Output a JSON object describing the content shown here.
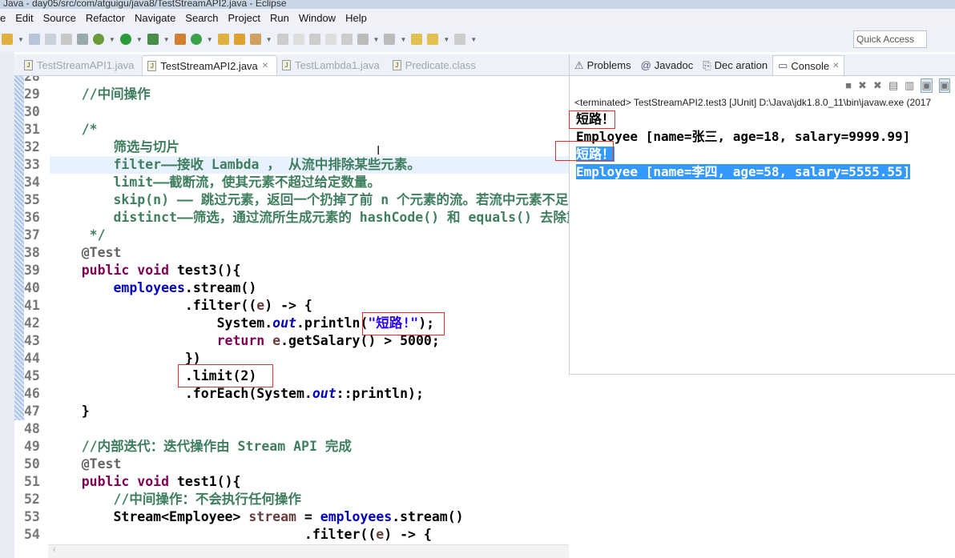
{
  "window": {
    "title": "Java - day05/src/com/atguigu/java8/TestStreamAPI2.java - Eclipse"
  },
  "menu": [
    "e",
    "Edit",
    "Source",
    "Refactor",
    "Navigate",
    "Search",
    "Project",
    "Run",
    "Window",
    "Help"
  ],
  "quick_access": "Quick Access",
  "editor_tabs": [
    {
      "label": "TestStreamAPI1.java",
      "active": false
    },
    {
      "label": "TestStreamAPI2.java",
      "active": true
    },
    {
      "label": "TestLambda1.java",
      "active": false
    },
    {
      "label": "Predicate.class",
      "active": false
    }
  ],
  "code": [
    {
      "n": "28",
      "t": []
    },
    {
      "n": "29",
      "t": [
        [
          "    "
        ],
        [
          "//中间操作",
          "cm"
        ]
      ]
    },
    {
      "n": "30",
      "t": []
    },
    {
      "n": "31",
      "t": [
        [
          "    "
        ],
        [
          "/*",
          "cm"
        ]
      ]
    },
    {
      "n": "32",
      "t": [
        [
          "        "
        ],
        [
          "筛选与切片",
          "cm"
        ]
      ]
    },
    {
      "n": "33",
      "hl": true,
      "t": [
        [
          "        "
        ],
        [
          "filter——接收 Lambda ， 从流中排除某些元素。",
          "cm"
        ]
      ]
    },
    {
      "n": "34",
      "t": [
        [
          "        "
        ],
        [
          "limit——截断流，使其元素不超过给定数量。",
          "cm"
        ]
      ]
    },
    {
      "n": "35",
      "t": [
        [
          "        "
        ],
        [
          "skip(n) —— 跳过元素，返回一个扔掉了前 n 个元素的流。若流中元素不足 n",
          "cm"
        ]
      ]
    },
    {
      "n": "36",
      "t": [
        [
          "        "
        ],
        [
          "distinct——筛选，通过流所生成元素的 hashCode() 和 equals() 去除重",
          "cm"
        ]
      ]
    },
    {
      "n": "37",
      "t": [
        [
          "     "
        ],
        [
          "*/",
          "cm"
        ]
      ]
    },
    {
      "n": "38",
      "t": [
        [
          "    "
        ],
        [
          "@Test",
          "an"
        ]
      ]
    },
    {
      "n": "39",
      "t": [
        [
          "    "
        ],
        [
          "public",
          "kw"
        ],
        [
          " "
        ],
        [
          "void",
          "kw"
        ],
        [
          " test3(){"
        ]
      ]
    },
    {
      "n": "40",
      "t": [
        [
          "        "
        ],
        [
          "employees",
          "fd"
        ],
        [
          ".stream()"
        ]
      ]
    },
    {
      "n": "41",
      "t": [
        [
          "                 .filter(("
        ],
        [
          "e",
          "pv"
        ],
        [
          ") -> {"
        ]
      ]
    },
    {
      "n": "42",
      "t": [
        [
          "                     System."
        ],
        [
          "out",
          "it"
        ],
        [
          ".println("
        ],
        [
          "\"短路!\"",
          "st"
        ],
        [
          ");"
        ]
      ]
    },
    {
      "n": "43",
      "t": [
        [
          "                     "
        ],
        [
          "return",
          "kw"
        ],
        [
          " "
        ],
        [
          "e",
          "pv"
        ],
        [
          ".getSalary() > 5000;"
        ]
      ]
    },
    {
      "n": "44",
      "t": [
        [
          "                 })"
        ]
      ]
    },
    {
      "n": "45",
      "t": [
        [
          "                 .limit(2)"
        ]
      ]
    },
    {
      "n": "46",
      "t": [
        [
          "                 .forEach(System."
        ],
        [
          "out",
          "it"
        ],
        [
          "::println);"
        ]
      ]
    },
    {
      "n": "47",
      "t": [
        [
          "    }"
        ]
      ]
    },
    {
      "n": "48",
      "t": []
    },
    {
      "n": "49",
      "t": [
        [
          "    "
        ],
        [
          "//内部迭代：迭代操作由 Stream API 完成",
          "cm"
        ]
      ]
    },
    {
      "n": "50",
      "t": [
        [
          "    "
        ],
        [
          "@Test",
          "an"
        ]
      ]
    },
    {
      "n": "51",
      "t": [
        [
          "    "
        ],
        [
          "public",
          "kw"
        ],
        [
          " "
        ],
        [
          "void",
          "kw"
        ],
        [
          " test1(){"
        ]
      ]
    },
    {
      "n": "52",
      "t": [
        [
          "        "
        ],
        [
          "//中间操作：不会执行任何操作",
          "cm"
        ]
      ]
    },
    {
      "n": "53",
      "t": [
        [
          "        Stream<Employee> "
        ],
        [
          "stream",
          "pv"
        ],
        [
          " = "
        ],
        [
          "employees",
          "fd"
        ],
        [
          ".stream()"
        ]
      ]
    },
    {
      "n": "54",
      "t": [
        [
          "                                .filter(("
        ],
        [
          "e",
          "pv"
        ],
        [
          ") -> {"
        ]
      ]
    }
  ],
  "console": {
    "tabs": [
      {
        "label": "Problems",
        "active": false
      },
      {
        "label": "Javadoc",
        "active": false
      },
      {
        "label": "Dec aration",
        "active": false
      },
      {
        "label": "Console",
        "active": true
      }
    ],
    "status": "<terminated> TestStreamAPI2.test3 [JUnit] D:\\Java\\jdk1.8.0_11\\bin\\javaw.exe (2017",
    "lines": [
      {
        "text": "短路！",
        "selected": false
      },
      {
        "text": "Employee [name=张三, age=18, salary=9999.99]",
        "selected": false
      },
      {
        "text": "短路！",
        "selected": true
      },
      {
        "text": "Employee [name=李四, age=58, salary=5555.55]",
        "selected": true
      }
    ]
  }
}
